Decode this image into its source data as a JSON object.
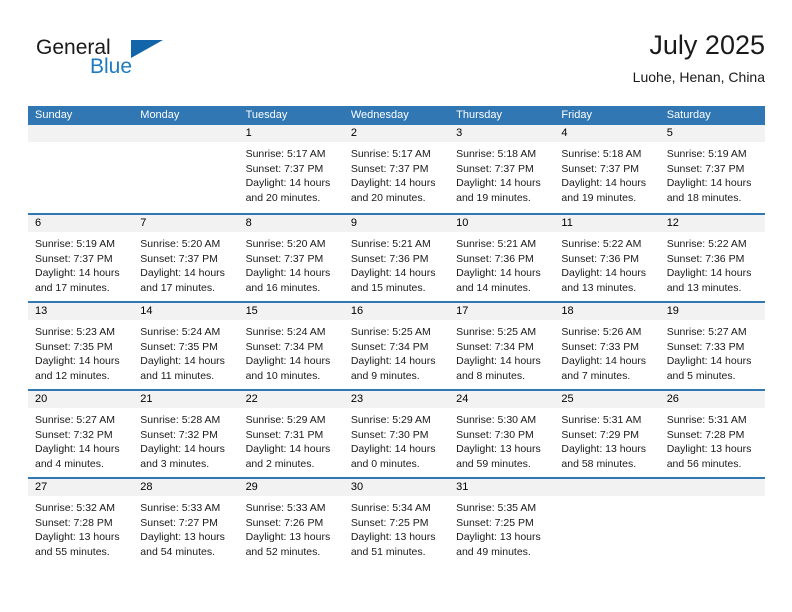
{
  "brand": {
    "name_part1": "General",
    "name_part2": "Blue",
    "triangle_color": "#1265a8",
    "blue_color": "#1f7bc1"
  },
  "header": {
    "title": "July 2025",
    "subtitle": "Luohe, Henan, China"
  },
  "theme": {
    "header_bar_color": "#3077b4",
    "day_band_color": "#f2f2f2",
    "text_color": "#1a1a1a"
  },
  "weekdays": [
    "Sunday",
    "Monday",
    "Tuesday",
    "Wednesday",
    "Thursday",
    "Friday",
    "Saturday"
  ],
  "weeks": [
    [
      {
        "day": "",
        "empty": true
      },
      {
        "day": "",
        "empty": true
      },
      {
        "day": "1",
        "sunrise": "Sunrise: 5:17 AM",
        "sunset": "Sunset: 7:37 PM",
        "daylight": "Daylight: 14 hours and 20 minutes."
      },
      {
        "day": "2",
        "sunrise": "Sunrise: 5:17 AM",
        "sunset": "Sunset: 7:37 PM",
        "daylight": "Daylight: 14 hours and 20 minutes."
      },
      {
        "day": "3",
        "sunrise": "Sunrise: 5:18 AM",
        "sunset": "Sunset: 7:37 PM",
        "daylight": "Daylight: 14 hours and 19 minutes."
      },
      {
        "day": "4",
        "sunrise": "Sunrise: 5:18 AM",
        "sunset": "Sunset: 7:37 PM",
        "daylight": "Daylight: 14 hours and 19 minutes."
      },
      {
        "day": "5",
        "sunrise": "Sunrise: 5:19 AM",
        "sunset": "Sunset: 7:37 PM",
        "daylight": "Daylight: 14 hours and 18 minutes."
      }
    ],
    [
      {
        "day": "6",
        "sunrise": "Sunrise: 5:19 AM",
        "sunset": "Sunset: 7:37 PM",
        "daylight": "Daylight: 14 hours and 17 minutes."
      },
      {
        "day": "7",
        "sunrise": "Sunrise: 5:20 AM",
        "sunset": "Sunset: 7:37 PM",
        "daylight": "Daylight: 14 hours and 17 minutes."
      },
      {
        "day": "8",
        "sunrise": "Sunrise: 5:20 AM",
        "sunset": "Sunset: 7:37 PM",
        "daylight": "Daylight: 14 hours and 16 minutes."
      },
      {
        "day": "9",
        "sunrise": "Sunrise: 5:21 AM",
        "sunset": "Sunset: 7:36 PM",
        "daylight": "Daylight: 14 hours and 15 minutes."
      },
      {
        "day": "10",
        "sunrise": "Sunrise: 5:21 AM",
        "sunset": "Sunset: 7:36 PM",
        "daylight": "Daylight: 14 hours and 14 minutes."
      },
      {
        "day": "11",
        "sunrise": "Sunrise: 5:22 AM",
        "sunset": "Sunset: 7:36 PM",
        "daylight": "Daylight: 14 hours and 13 minutes."
      },
      {
        "day": "12",
        "sunrise": "Sunrise: 5:22 AM",
        "sunset": "Sunset: 7:36 PM",
        "daylight": "Daylight: 14 hours and 13 minutes."
      }
    ],
    [
      {
        "day": "13",
        "sunrise": "Sunrise: 5:23 AM",
        "sunset": "Sunset: 7:35 PM",
        "daylight": "Daylight: 14 hours and 12 minutes."
      },
      {
        "day": "14",
        "sunrise": "Sunrise: 5:24 AM",
        "sunset": "Sunset: 7:35 PM",
        "daylight": "Daylight: 14 hours and 11 minutes."
      },
      {
        "day": "15",
        "sunrise": "Sunrise: 5:24 AM",
        "sunset": "Sunset: 7:34 PM",
        "daylight": "Daylight: 14 hours and 10 minutes."
      },
      {
        "day": "16",
        "sunrise": "Sunrise: 5:25 AM",
        "sunset": "Sunset: 7:34 PM",
        "daylight": "Daylight: 14 hours and 9 minutes."
      },
      {
        "day": "17",
        "sunrise": "Sunrise: 5:25 AM",
        "sunset": "Sunset: 7:34 PM",
        "daylight": "Daylight: 14 hours and 8 minutes."
      },
      {
        "day": "18",
        "sunrise": "Sunrise: 5:26 AM",
        "sunset": "Sunset: 7:33 PM",
        "daylight": "Daylight: 14 hours and 7 minutes."
      },
      {
        "day": "19",
        "sunrise": "Sunrise: 5:27 AM",
        "sunset": "Sunset: 7:33 PM",
        "daylight": "Daylight: 14 hours and 5 minutes."
      }
    ],
    [
      {
        "day": "20",
        "sunrise": "Sunrise: 5:27 AM",
        "sunset": "Sunset: 7:32 PM",
        "daylight": "Daylight: 14 hours and 4 minutes."
      },
      {
        "day": "21",
        "sunrise": "Sunrise: 5:28 AM",
        "sunset": "Sunset: 7:32 PM",
        "daylight": "Daylight: 14 hours and 3 minutes."
      },
      {
        "day": "22",
        "sunrise": "Sunrise: 5:29 AM",
        "sunset": "Sunset: 7:31 PM",
        "daylight": "Daylight: 14 hours and 2 minutes."
      },
      {
        "day": "23",
        "sunrise": "Sunrise: 5:29 AM",
        "sunset": "Sunset: 7:30 PM",
        "daylight": "Daylight: 14 hours and 0 minutes."
      },
      {
        "day": "24",
        "sunrise": "Sunrise: 5:30 AM",
        "sunset": "Sunset: 7:30 PM",
        "daylight": "Daylight: 13 hours and 59 minutes."
      },
      {
        "day": "25",
        "sunrise": "Sunrise: 5:31 AM",
        "sunset": "Sunset: 7:29 PM",
        "daylight": "Daylight: 13 hours and 58 minutes."
      },
      {
        "day": "26",
        "sunrise": "Sunrise: 5:31 AM",
        "sunset": "Sunset: 7:28 PM",
        "daylight": "Daylight: 13 hours and 56 minutes."
      }
    ],
    [
      {
        "day": "27",
        "sunrise": "Sunrise: 5:32 AM",
        "sunset": "Sunset: 7:28 PM",
        "daylight": "Daylight: 13 hours and 55 minutes."
      },
      {
        "day": "28",
        "sunrise": "Sunrise: 5:33 AM",
        "sunset": "Sunset: 7:27 PM",
        "daylight": "Daylight: 13 hours and 54 minutes."
      },
      {
        "day": "29",
        "sunrise": "Sunrise: 5:33 AM",
        "sunset": "Sunset: 7:26 PM",
        "daylight": "Daylight: 13 hours and 52 minutes."
      },
      {
        "day": "30",
        "sunrise": "Sunrise: 5:34 AM",
        "sunset": "Sunset: 7:25 PM",
        "daylight": "Daylight: 13 hours and 51 minutes."
      },
      {
        "day": "31",
        "sunrise": "Sunrise: 5:35 AM",
        "sunset": "Sunset: 7:25 PM",
        "daylight": "Daylight: 13 hours and 49 minutes."
      },
      {
        "day": "",
        "empty": true
      },
      {
        "day": "",
        "empty": true
      }
    ]
  ]
}
